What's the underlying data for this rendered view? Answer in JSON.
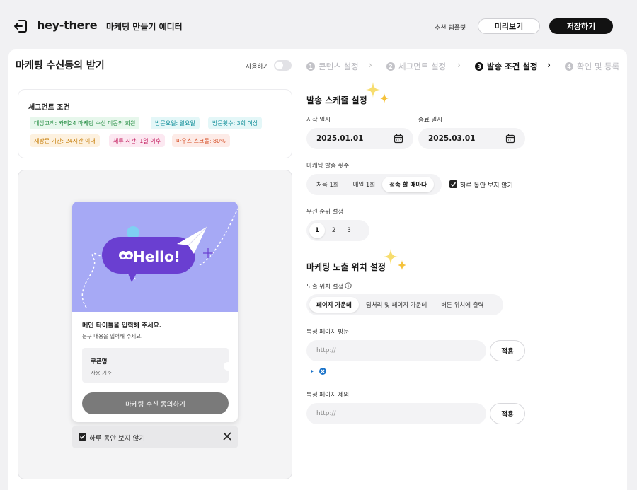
{
  "header": {
    "logo": "hey-there",
    "subtitle": "마케팅 만들기 에디터",
    "recommend_label": "추천 템플릿",
    "preview_label": "미리보기",
    "save_label": "저장하기"
  },
  "page": {
    "title": "마케팅 수신동의 받기",
    "toggle_label": "사용하기",
    "toggle_on": false
  },
  "steps": [
    {
      "num": "1",
      "label": "콘텐츠 설정",
      "active": false
    },
    {
      "num": "2",
      "label": "세그먼트 설정",
      "active": false
    },
    {
      "num": "3",
      "label": "발송 조건 설정",
      "active": true
    },
    {
      "num": "4",
      "label": "확인 및 등록",
      "active": false
    }
  ],
  "segment": {
    "title": "세그먼트 조건",
    "chips": [
      {
        "text": "대상고객: 카페24 마케팅 수신 미동의 회원",
        "color": "#1d8a3c"
      },
      {
        "text": "방문요일: 일요일",
        "color": "#0c8c97"
      },
      {
        "text": "방문횟수: 3회 이상",
        "color": "#0c8c97"
      },
      {
        "text": "재방문 기간: 24시간 이내",
        "color": "#c77f0b"
      },
      {
        "text": "체류 시간: 1일 이후",
        "color": "#c2185b"
      },
      {
        "text": "마우스 스크롤: 80%",
        "color": "#d4491f"
      }
    ]
  },
  "popup": {
    "hello_text": "Hello!",
    "main_title": "메인 타이틀을 입력해 주세요.",
    "desc": "문구 내용을 입력해 주세요.",
    "coupon_name": "쿠폰명",
    "coupon_sub": "사용 기준",
    "agree_button": "마케팅 수신 동의하기",
    "dont_show": "하루 동안 보지 않기"
  },
  "schedule": {
    "title": "발송 스케줄 설정",
    "start_label": "시작 일시",
    "start_value": "2025.01.01",
    "end_label": "종료 일시",
    "end_value": "2025.03.01",
    "count_label": "마케팅 발송 횟수",
    "count_options": [
      "처음 1회",
      "매일 1회",
      "접속 할 때마다"
    ],
    "count_selected": "접속 할 때마다",
    "dont_show_label": "하루 동안 보지 않기",
    "dont_show_checked": true,
    "priority_label": "우선 순위 설정",
    "priority_options": [
      "1",
      "2",
      "3"
    ],
    "priority_selected": "1"
  },
  "exposure": {
    "title": "마케팅 노출 위치 설정",
    "position_label": "노출 위치 설정",
    "position_options": [
      "페이지 가운데",
      "딤처리 및 페이지 가운데",
      "버튼 위치에 출력"
    ],
    "position_selected": "페이지 가운데",
    "visit_label": "특정 페이지 방문",
    "visit_placeholder": "http://",
    "visit_apply": "적용",
    "exclude_label": "특정 페이지 제외",
    "exclude_placeholder": "http://",
    "exclude_apply": "적용"
  },
  "colors": {
    "accent_dark": "#121212",
    "popup_bg": "#a6a9f5",
    "bubble": "#6a3fd1",
    "sparkle": "#f5c23a"
  }
}
